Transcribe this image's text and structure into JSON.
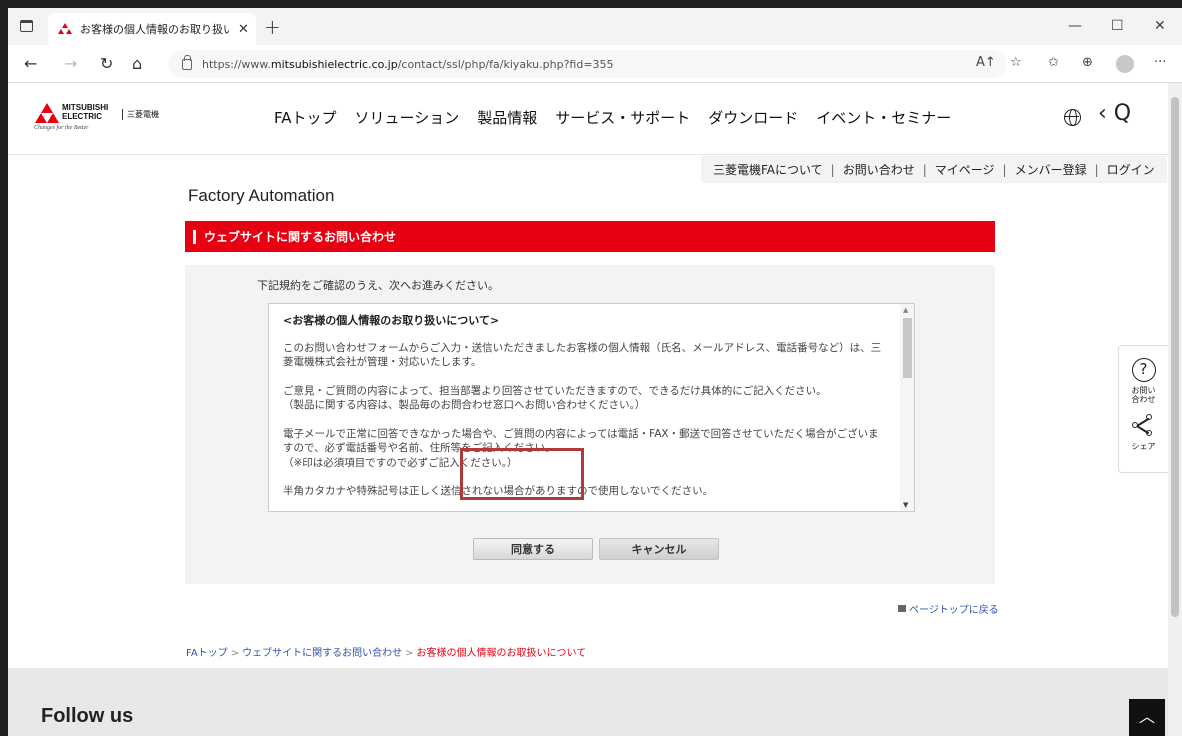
{
  "browser": {
    "tab_title": "お客様の個人情報のお取り扱いにつ",
    "url_prefix": "https://www.",
    "url_domain": "mitsubishielectric.co.jp",
    "url_path": "/contact/ssl/php/fa/kiyaku.php?fid=355"
  },
  "header": {
    "logo_word1": "MITSUBISHI",
    "logo_word2": "ELECTRIC",
    "logo_jp": "三菱電機",
    "logo_tag": "Changes for the Better",
    "nav": [
      "FAトップ",
      "ソリューション",
      "製品情報",
      "サービス・サポート",
      "ダウンロード",
      "イベント・セミナー"
    ]
  },
  "utility_nav": [
    "三菱電機FAについて",
    "お問い合わせ",
    "マイページ",
    "メンバー登録",
    "ログイン"
  ],
  "page": {
    "site_title": "Factory Automation",
    "section_title": "ウェブサイトに関するお問い合わせ",
    "intro": "下記規約をご確認のうえ、次へお進みください。",
    "terms_heading": "<お客様の個人情報のお取り扱いについて>",
    "terms_p1": "このお問い合わせフォームからご入力・送信いただきましたお客様の個人情報（氏名、メールアドレス、電話番号など）は、三菱電機株式会社が管理・対応いたします。",
    "terms_p2a": "ご意見・ご質問の内容によって、担当部署より回答させていただきますので、できるだけ具体的にご記入ください。",
    "terms_p2b": "（製品に関する内容は、製品毎のお問合わせ窓口へお問い合わせください。）",
    "terms_p3a": "電子メールで正常に回答できなかった場合や、ご質問の内容によっては電話・FAX・郵送で回答させていただく場合がございますので、必ず電話番号や名前、住所等をご記入ください。",
    "terms_p3b": "（※印は必須項目ですので必ずご記入ください。）",
    "terms_p4": "半角カタカナや特殊記号は正しく送信されない場合がありますので使用しないでください。",
    "agree_label": "同意する",
    "cancel_label": "キャンセル",
    "pagetop_label": "ページトップに戻る"
  },
  "breadcrumb": {
    "items": [
      "FAトップ",
      "ウェブサイトに関するお問い合わせ"
    ],
    "current": "お客様の個人情報のお取扱いについて"
  },
  "side_float": {
    "contact_label_1": "お問い",
    "contact_label_2": "合わせ",
    "share_label": "シェア"
  },
  "footer": {
    "follow_label": "Follow us"
  },
  "colors": {
    "brand_red": "#e60012",
    "link_blue": "#3355aa",
    "highlight": "#b03a3a"
  }
}
